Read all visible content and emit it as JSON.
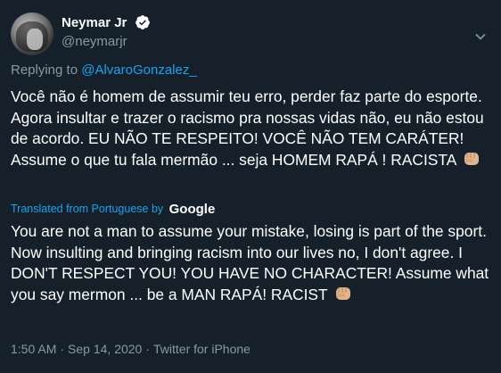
{
  "author": {
    "display_name": "Neymar Jr",
    "handle": "@neymarjr",
    "verified": true
  },
  "reply": {
    "prefix": "Replying to",
    "mention": "@AlvaroGonzalez_"
  },
  "tweet_text": "Você não é homem de assumir teu erro, perder faz parte do esporte. Agora insultar e trazer o racismo pra nossas vidas não, eu não estou de acordo. EU NÃO TE RESPEITO! VOCÊ NÃO TEM CARÁTER! Assume o que tu fala mermão ... seja HOMEM RAPÁ ! RACISTA",
  "translation": {
    "label": "Translated from Portuguese by",
    "provider": "Google",
    "text": "You are not a man to assume your mistake, losing is part of the sport. Now insulting and bringing racism into our lives no, I don't agree. I DON'T RESPECT YOU! YOU HAVE NO CHARACTER! Assume what you say mermon ... be a MAN RAPÁ! RACIST"
  },
  "meta": {
    "time": "1:50 AM",
    "date": "Sep 14, 2020",
    "source": "Twitter for iPhone",
    "separator": "·"
  },
  "colors": {
    "background": "#15202b",
    "link": "#1da1f2",
    "secondary_text": "#8899a6"
  },
  "icons": [
    "verified-badge-icon",
    "chevron-down-icon",
    "raised-fist-emoji"
  ]
}
